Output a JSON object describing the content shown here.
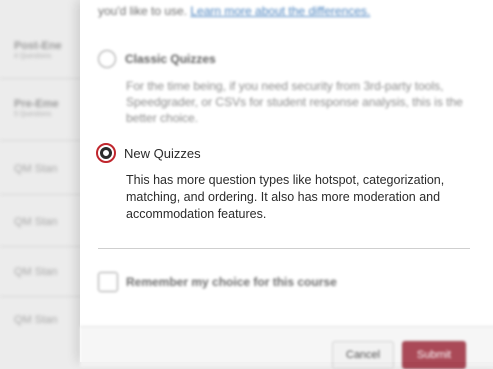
{
  "background_list": [
    {
      "title": "Post-Ene",
      "sub": "4 Questions"
    },
    {
      "title": "Pre-Eme",
      "sub": "5 Questions"
    },
    {
      "title": "QM Stan",
      "sub": ""
    },
    {
      "title": "QM Stan",
      "sub": ""
    },
    {
      "title": "QM Stan",
      "sub": ""
    },
    {
      "title": "QM Stan",
      "sub": ""
    }
  ],
  "modal": {
    "intro_text": "you'd like to use.",
    "intro_link": "Learn more about the differences.",
    "options": [
      {
        "title": "Classic Quizzes",
        "description": "For the time being, if you need security from 3rd-party tools, Speedgrader, or CSVs for student response analysis, this is the better choice.",
        "selected": false
      },
      {
        "title": "New Quizzes",
        "description": "This has more question types like hotspot, categorization, matching, and ordering. It also has more moderation and accommodation features.",
        "selected": true
      }
    ],
    "remember_label": "Remember my choice for this course",
    "cancel_label": "Cancel",
    "submit_label": "Submit"
  },
  "colors": {
    "accent": "#c0262d",
    "submit_bg": "#9c2a3a",
    "link": "#2d6fb5"
  }
}
